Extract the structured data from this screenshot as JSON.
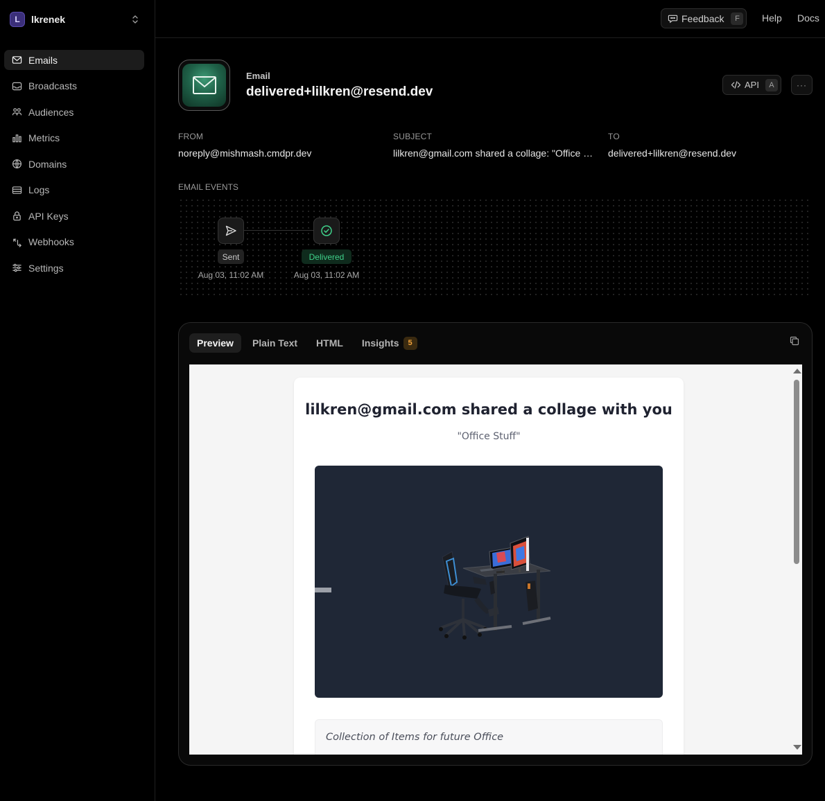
{
  "team": {
    "initial": "L",
    "name": "lkrenek"
  },
  "sidebar": {
    "items": [
      {
        "label": "Emails",
        "icon": "mail-icon",
        "active": true
      },
      {
        "label": "Broadcasts",
        "icon": "inbox-icon"
      },
      {
        "label": "Audiences",
        "icon": "users-icon"
      },
      {
        "label": "Metrics",
        "icon": "bar-chart-icon"
      },
      {
        "label": "Domains",
        "icon": "globe-icon"
      },
      {
        "label": "Logs",
        "icon": "list-icon"
      },
      {
        "label": "API Keys",
        "icon": "lock-icon"
      },
      {
        "label": "Webhooks",
        "icon": "webhook-icon"
      },
      {
        "label": "Settings",
        "icon": "sliders-icon"
      }
    ]
  },
  "header": {
    "feedback_label": "Feedback",
    "feedback_key": "F",
    "help_label": "Help",
    "docs_label": "Docs"
  },
  "email": {
    "kicker": "Email",
    "title": "delivered+lilkren@resend.dev",
    "api_label": "API",
    "api_key": "A",
    "more_label": "···",
    "from_label": "FROM",
    "from_value": "noreply@mishmash.cmdpr.dev",
    "subject_label": "SUBJECT",
    "subject_value": "lilkren@gmail.com shared a collage: \"Office S...",
    "to_label": "TO",
    "to_value": "delivered+lilkren@resend.dev"
  },
  "events": {
    "label": "EMAIL EVENTS",
    "items": [
      {
        "status": "Sent",
        "time": "Aug 03, 11:02 AM"
      },
      {
        "status": "Delivered",
        "time": "Aug 03, 11:02 AM"
      }
    ]
  },
  "preview": {
    "tabs": [
      {
        "label": "Preview",
        "active": true
      },
      {
        "label": "Plain Text"
      },
      {
        "label": "HTML"
      },
      {
        "label": "Insights",
        "badge": "5"
      }
    ],
    "mail": {
      "title": "lilkren@gmail.com shared a collage with you",
      "subtitle": "\"Office Stuff\"",
      "note": "Collection of Items for future Office"
    }
  },
  "colors": {
    "background": "#000000",
    "sidebar_active": "#1c1c1c",
    "delivered_green": "#3fd18a",
    "insights_badge": "#f0a23a"
  }
}
